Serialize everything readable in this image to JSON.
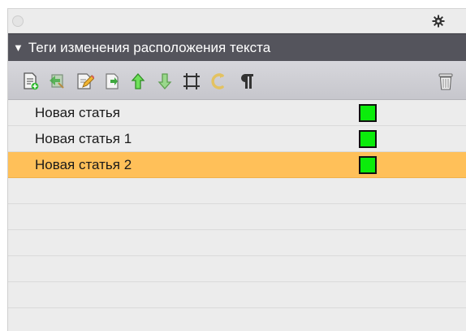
{
  "panel": {
    "title": "Теги изменения расположения текста",
    "collapse_icon": "triangle-down-icon",
    "settings_icon": "gear-icon"
  },
  "toolbar": {
    "icons": [
      "new-tag-icon",
      "import-tag-icon",
      "edit-tag-icon",
      "duplicate-tag-icon",
      "move-up-icon",
      "move-down-icon",
      "frame-icon",
      "rotate-icon",
      "paragraph-icon",
      "trash-icon"
    ]
  },
  "tags": [
    {
      "name": "Новая статья",
      "color": "#0bec0b",
      "selected": false
    },
    {
      "name": "Новая статья 1",
      "color": "#0bec0b",
      "selected": false
    },
    {
      "name": "Новая статья 2",
      "color": "#0bec0b",
      "selected": true
    }
  ],
  "colors": {
    "header_bg": "#54545c",
    "selection": "#ffc059",
    "tag_color": "#0bec0b"
  }
}
